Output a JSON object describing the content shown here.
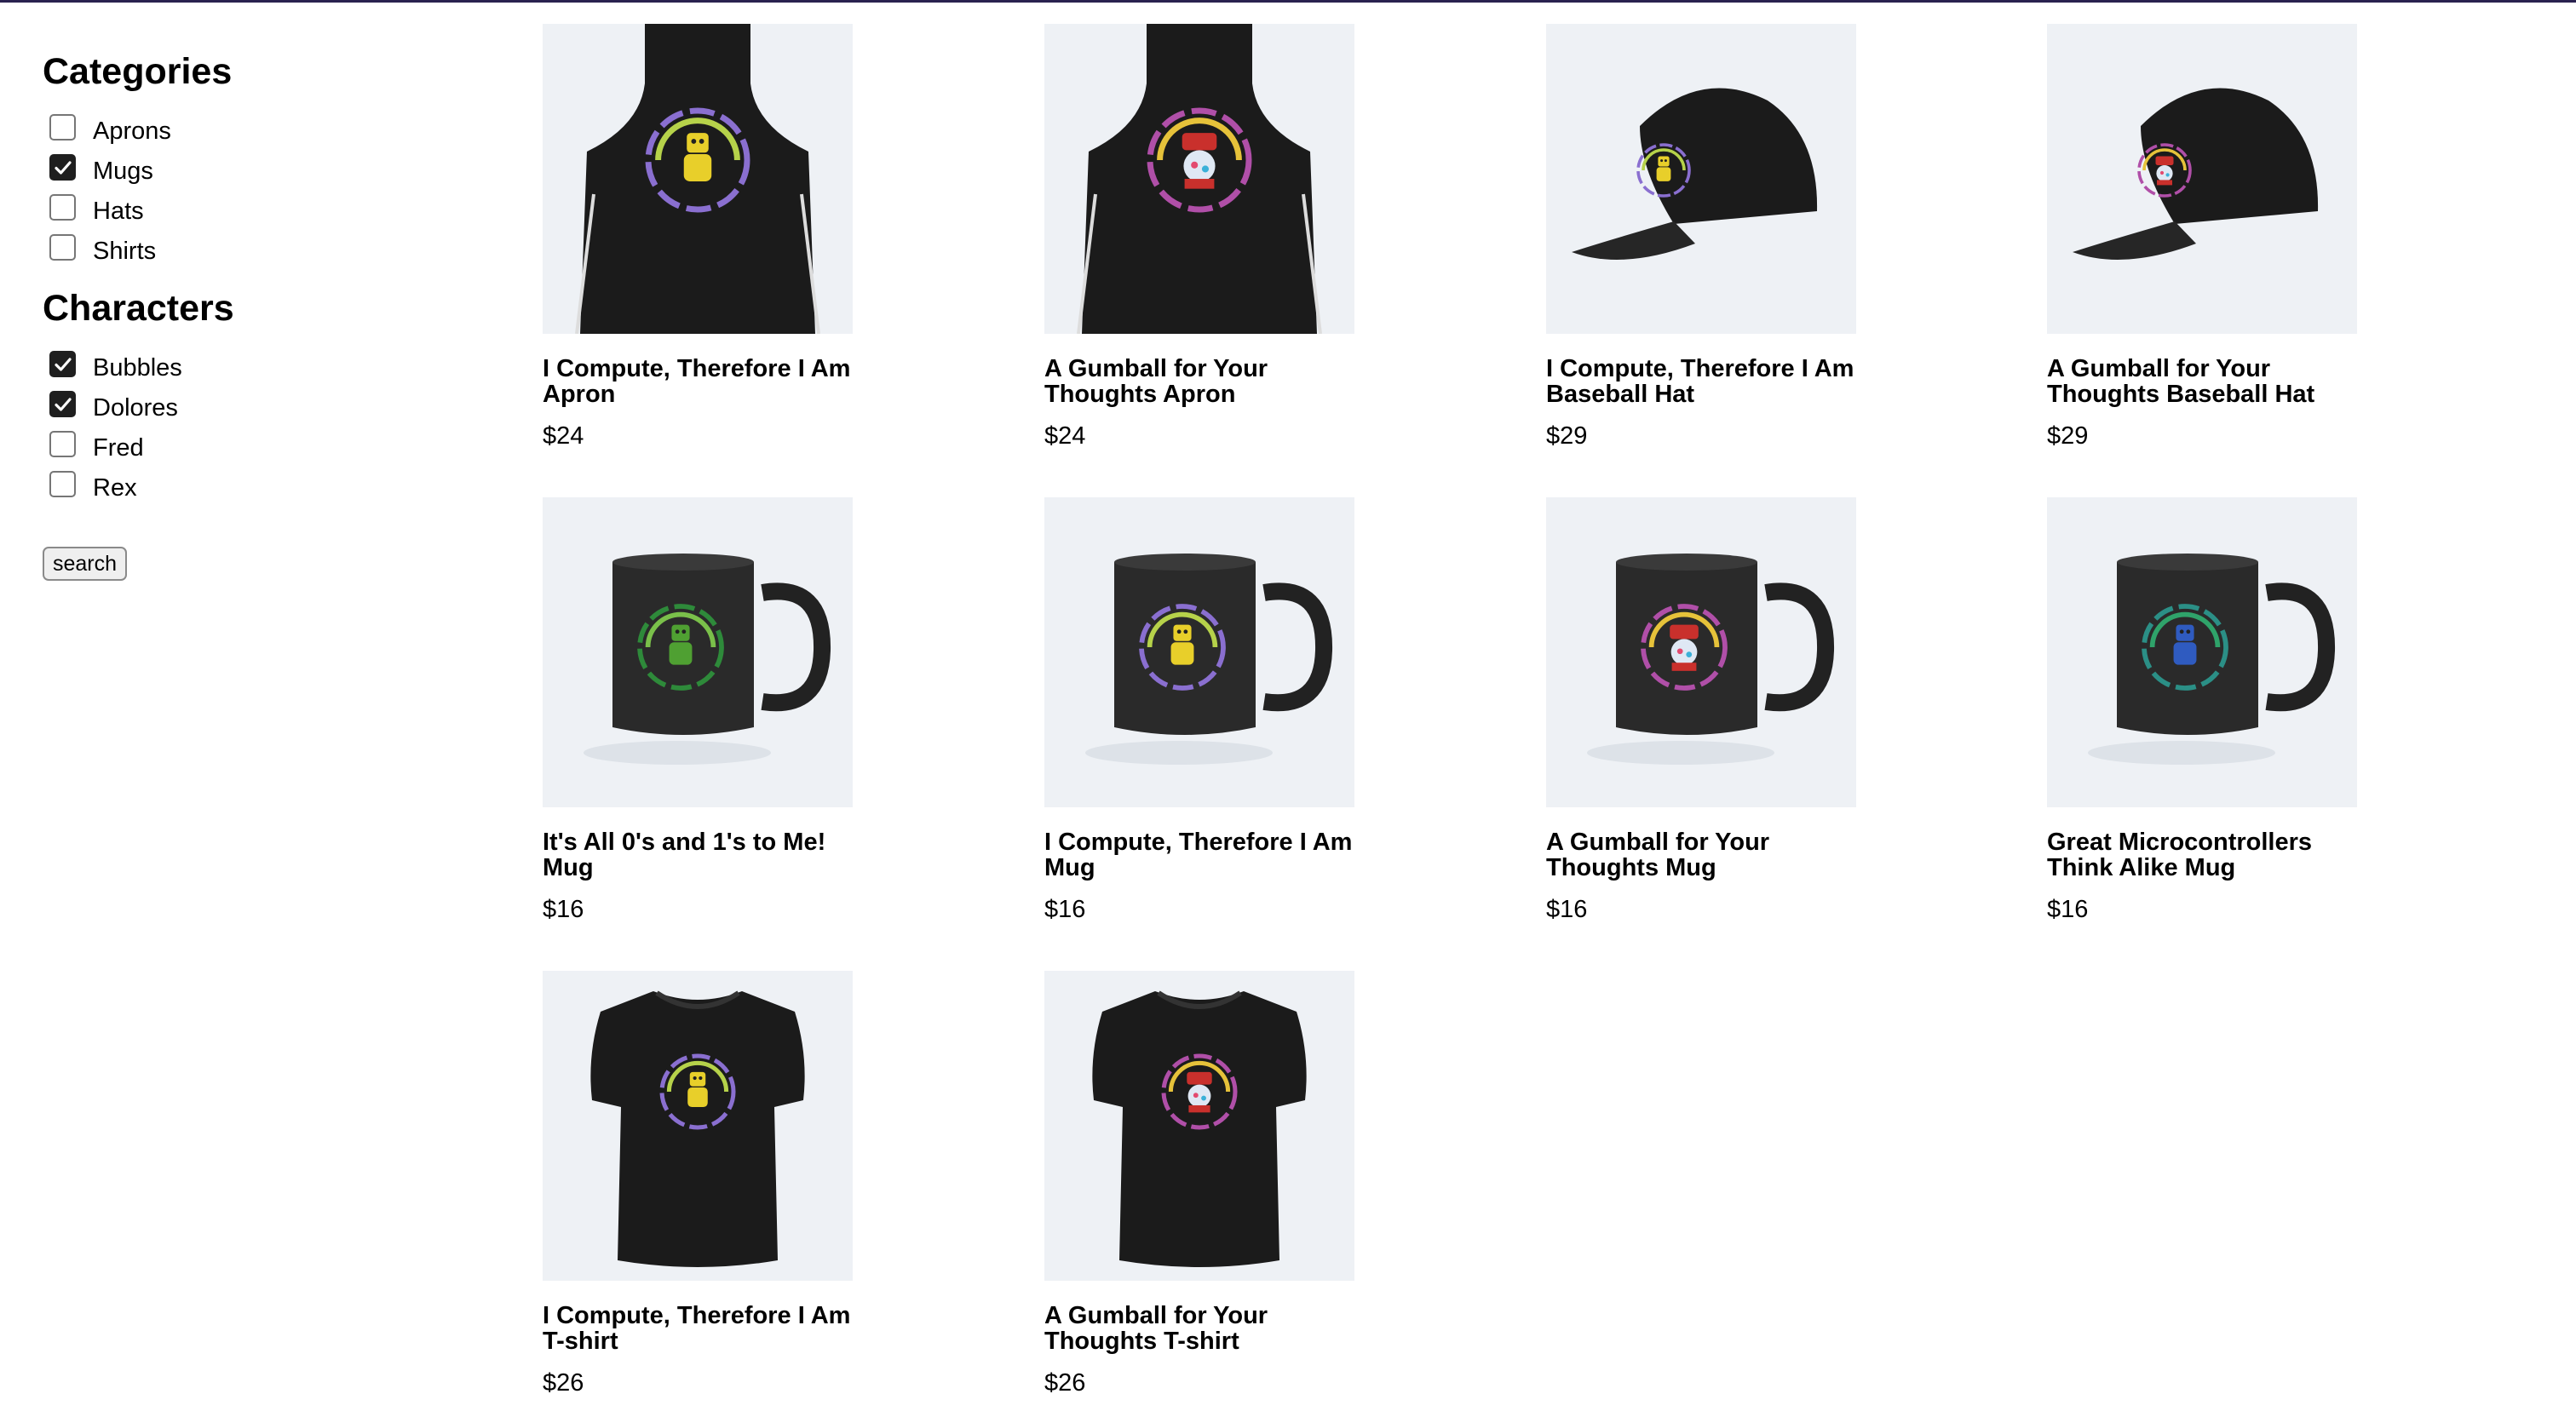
{
  "filters": {
    "categories": {
      "title": "Categories",
      "items": [
        {
          "label": "Aprons",
          "checked": false
        },
        {
          "label": "Mugs",
          "checked": true
        },
        {
          "label": "Hats",
          "checked": false
        },
        {
          "label": "Shirts",
          "checked": false
        }
      ]
    },
    "characters": {
      "title": "Characters",
      "items": [
        {
          "label": "Bubbles",
          "checked": true
        },
        {
          "label": "Dolores",
          "checked": true
        },
        {
          "label": "Fred",
          "checked": false
        },
        {
          "label": "Rex",
          "checked": false
        }
      ]
    },
    "search_label": "search"
  },
  "products": [
    {
      "name": "I Compute, Therefore I Am Apron",
      "price": "$24",
      "type": "apron",
      "character": "yellow-robot"
    },
    {
      "name": "A Gumball for Your Thoughts Apron",
      "price": "$24",
      "type": "apron",
      "character": "gumball-robot"
    },
    {
      "name": "I Compute, Therefore I Am Baseball Hat",
      "price": "$29",
      "type": "hat",
      "character": "yellow-robot"
    },
    {
      "name": "A Gumball for Your Thoughts Baseball Hat",
      "price": "$29",
      "type": "hat",
      "character": "gumball-robot"
    },
    {
      "name": "It's All 0's and 1's to Me! Mug",
      "price": "$16",
      "type": "mug",
      "character": "green-robot"
    },
    {
      "name": "I Compute, Therefore I Am Mug",
      "price": "$16",
      "type": "mug",
      "character": "yellow-robot"
    },
    {
      "name": "A Gumball for Your Thoughts Mug",
      "price": "$16",
      "type": "mug",
      "character": "gumball-robot"
    },
    {
      "name": "Great Microcontrollers Think Alike Mug",
      "price": "$16",
      "type": "mug",
      "character": "blue-robot"
    },
    {
      "name": "I Compute, Therefore I Am T-shirt",
      "price": "$26",
      "type": "shirt",
      "character": "yellow-robot"
    },
    {
      "name": "A Gumball for Your Thoughts T-shirt",
      "price": "$26",
      "type": "shirt",
      "character": "gumball-robot"
    }
  ],
  "colors": {
    "product_black": "#1b1b1b",
    "thumb_background": "#eef1f5",
    "checkbox_checked": "#1f1f1f"
  }
}
